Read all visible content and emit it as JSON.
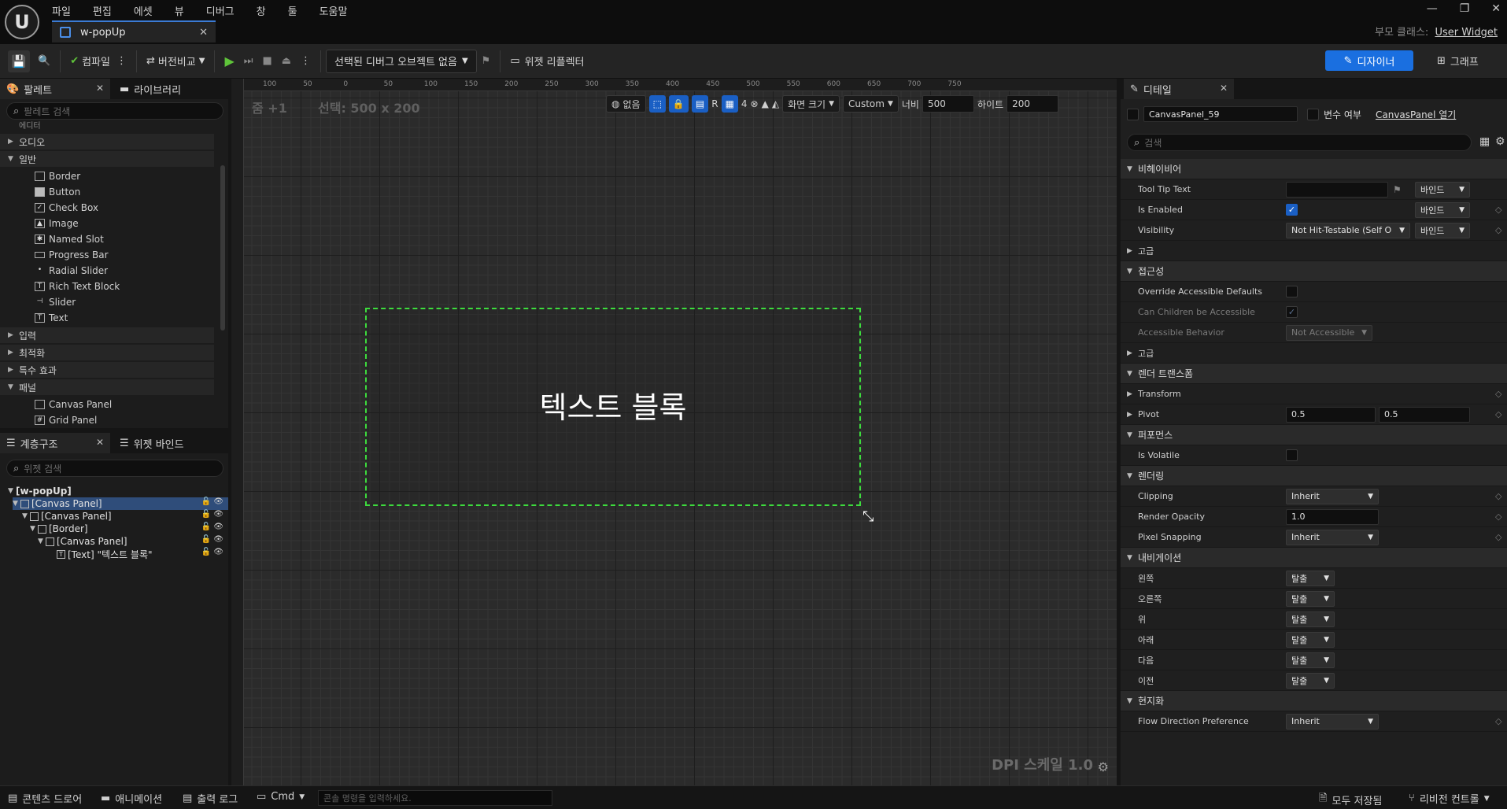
{
  "app": {
    "logo_text": "U",
    "menu": [
      "파일",
      "편집",
      "에셋",
      "뷰",
      "디버그",
      "창",
      "툴",
      "도움말"
    ],
    "doc_tab": "w-popUp",
    "parent_class_label": "부모 클래스:",
    "parent_class_value": "User Widget"
  },
  "window_controls": [
    "—",
    "❐",
    "✕"
  ],
  "toolbar": {
    "compile": "컴파일",
    "diff": "버전비교",
    "debug_select": "선택된 디버그 오브젝트 없음",
    "reflector": "위젯 리플렉터",
    "designer": "디자이너",
    "graph": "그래프"
  },
  "palette": {
    "tab": "팔레트",
    "library_tab": "라이브러리",
    "search_placeholder": "팔레트 검색",
    "partial": "에디터",
    "categories": [
      "오디오",
      "일반",
      "입력",
      "최적화",
      "특수 효과",
      "패널"
    ],
    "common_items": [
      "Border",
      "Button",
      "Check Box",
      "Image",
      "Named Slot",
      "Progress Bar",
      "Radial Slider",
      "Rich Text Block",
      "Slider",
      "Text"
    ],
    "panel_items": [
      "Canvas Panel",
      "Grid Panel"
    ]
  },
  "hierarchy": {
    "tab": "계층구조",
    "bind_tab": "위젯 바인드",
    "search_placeholder": "위젯 검색",
    "items": [
      "[w-popUp]",
      "[Canvas Panel]",
      "[Canvas Panel]",
      "[Border]",
      "[Canvas Panel]",
      "[Text] \"텍스트 블록\""
    ]
  },
  "canvas": {
    "zoom": "줌 +1",
    "selection": "선택: 500 x 200",
    "ruler_top": [
      "100",
      "50",
      "0",
      "50",
      "100",
      "150",
      "200",
      "250",
      "300",
      "350",
      "400",
      "450",
      "500",
      "550",
      "600",
      "650",
      "700",
      "750"
    ],
    "none_label": "없음",
    "r_label": "R",
    "grid_count": "4",
    "screen_size": "화면 크기",
    "custom": "Custom",
    "width_label": "너비",
    "width_value": "500",
    "height_label": "하이트",
    "height_value": "200",
    "text_block": "텍스트 블록",
    "dpi": "DPI 스케일 1.0"
  },
  "details": {
    "tab": "디테일",
    "widget_name": "CanvasPanel_59",
    "is_variable": "변수 여부",
    "open_link": "CanvasPanel 열기",
    "search_placeholder": "검색",
    "sections": {
      "behavior": "비헤이비어",
      "advanced": "고급",
      "accessibility": "접근성",
      "render_transform": "렌더 트랜스폼",
      "performance": "퍼포먼스",
      "rendering": "렌더링",
      "navigation": "내비게이션",
      "localization": "현지화"
    },
    "bind": "바인드",
    "tooltip": "Tool Tip Text",
    "is_enabled": "Is Enabled",
    "visibility": "Visibility",
    "visibility_value": "Not Hit-Testable (Self O",
    "override_acc": "Override Accessible Defaults",
    "children_acc": "Can Children be Accessible",
    "acc_behavior": "Accessible Behavior",
    "acc_behavior_value": "Not Accessible",
    "transform": "Transform",
    "pivot": "Pivot",
    "pivot_x": "0.5",
    "pivot_y": "0.5",
    "is_volatile": "Is Volatile",
    "clipping": "Clipping",
    "clipping_value": "Inherit",
    "render_opacity": "Render Opacity",
    "render_opacity_value": "1.0",
    "pixel_snapping": "Pixel Snapping",
    "pixel_snapping_value": "Inherit",
    "nav": [
      {
        "label": "왼쪽",
        "value": "탈출"
      },
      {
        "label": "오른쪽",
        "value": "탈출"
      },
      {
        "label": "위",
        "value": "탈출"
      },
      {
        "label": "아래",
        "value": "탈출"
      },
      {
        "label": "다음",
        "value": "탈출"
      },
      {
        "label": "이전",
        "value": "탈출"
      }
    ],
    "flow_direction": "Flow Direction Preference",
    "flow_direction_value": "Inherit"
  },
  "statusbar": {
    "content_drawer": "콘텐츠 드로어",
    "animation": "애니메이션",
    "output_log": "출력 로그",
    "cmd": "Cmd",
    "console_placeholder": "콘솔 명령을 입력하세요.",
    "save_all": "모두 저장됨",
    "revision": "리비전 컨트롤"
  },
  "colors": {
    "accent_blue": "#1a6fe0",
    "selection_green": "#3ddc3d",
    "play_green": "#5fc43a"
  }
}
